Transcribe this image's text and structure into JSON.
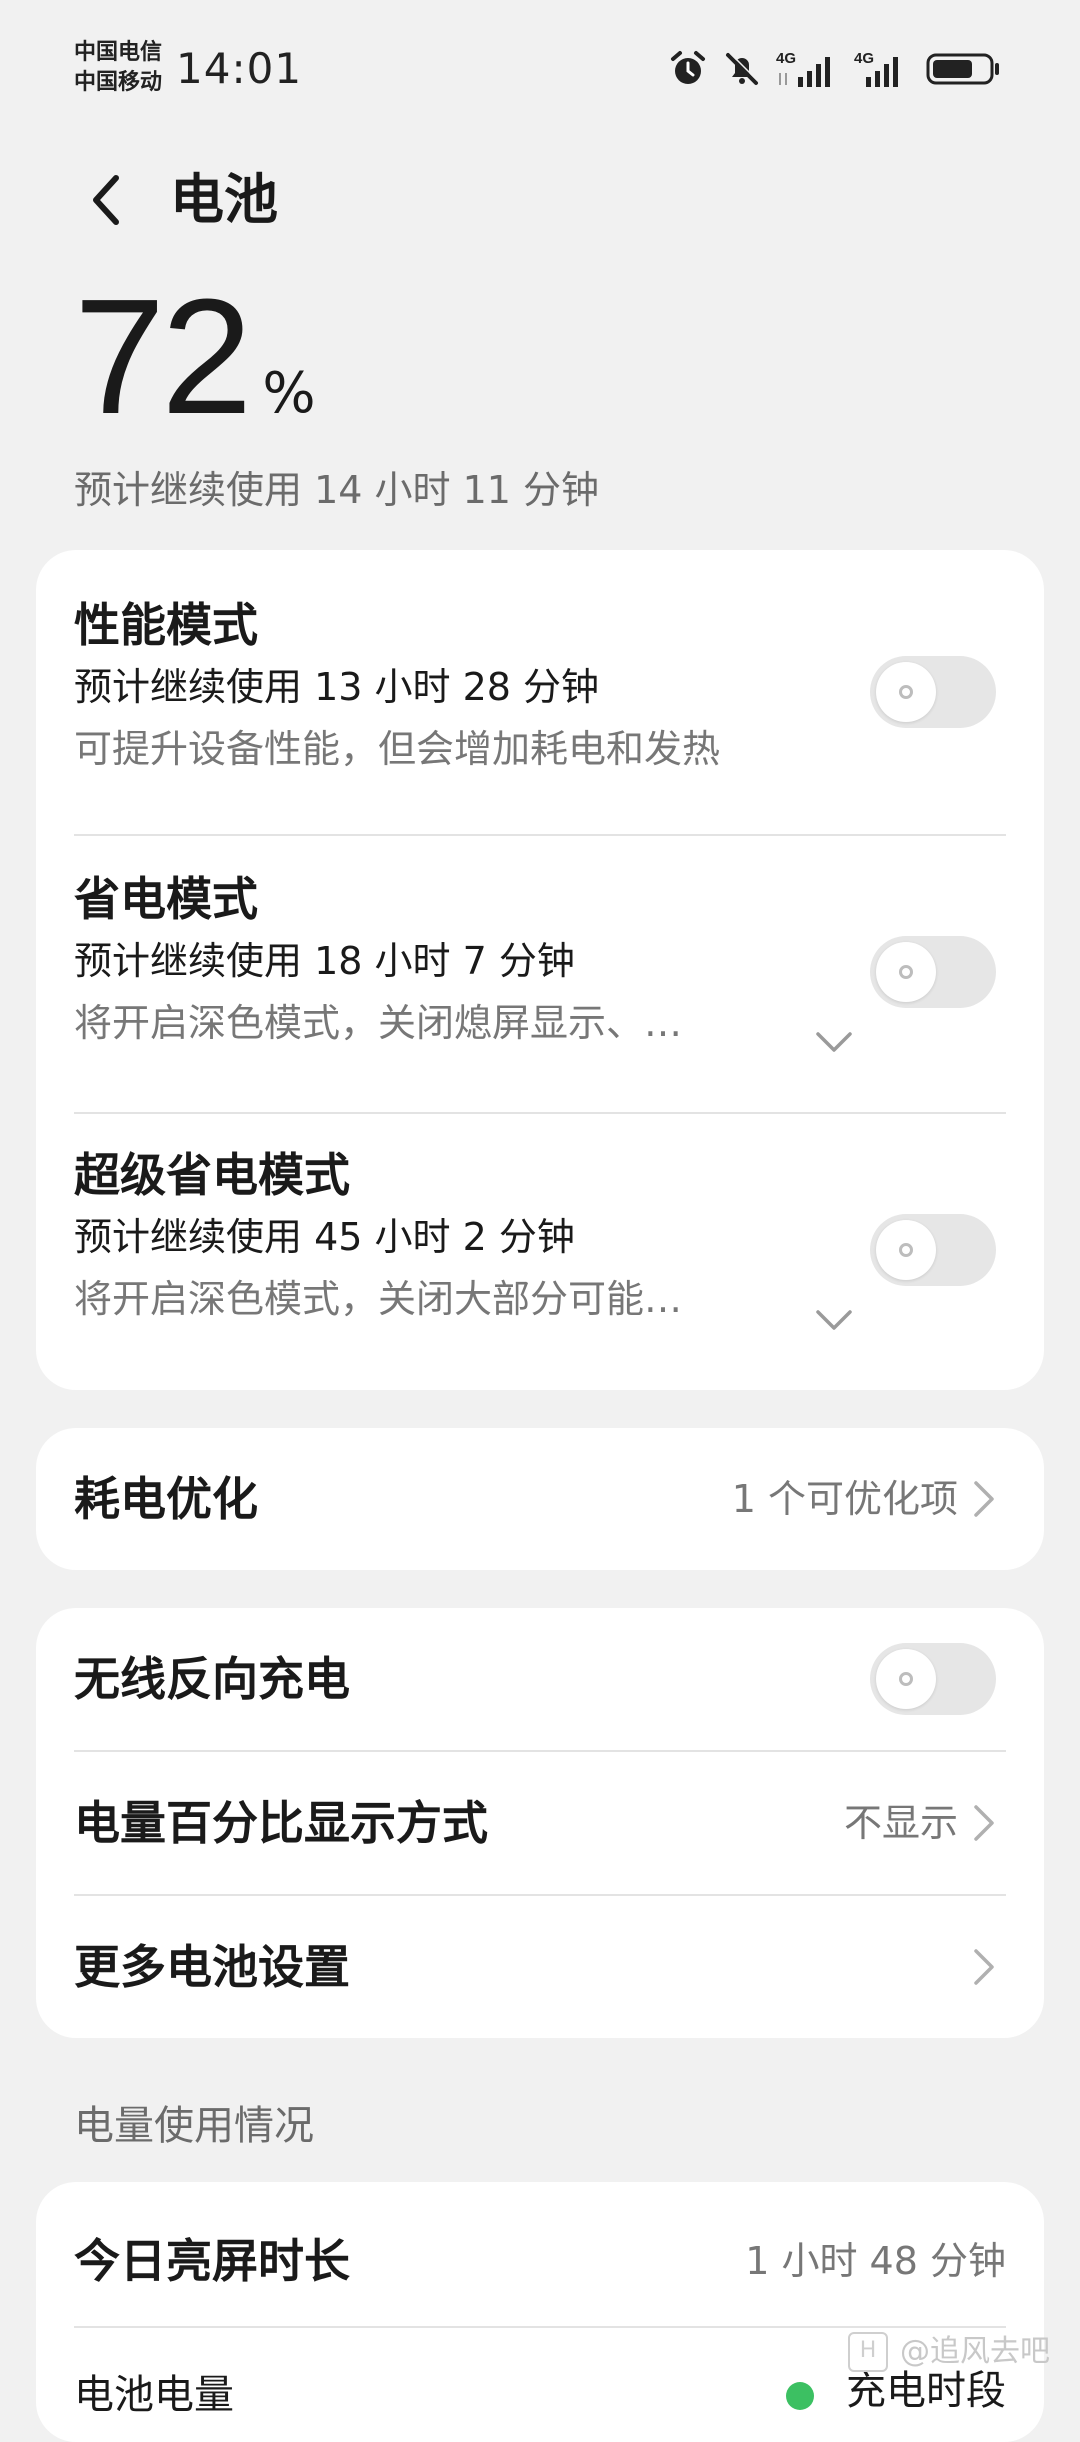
{
  "status_bar": {
    "carrier_1": "中国电信",
    "carrier_2": "中国移动",
    "time": "14:01",
    "icons": [
      "alarm-icon",
      "mute-bell-icon",
      "signal-4g-icon",
      "signal-4g-icon",
      "battery-icon"
    ],
    "network_1": "4G",
    "network_2": "4G",
    "battery_fill": 0.72
  },
  "header": {
    "title": "电池"
  },
  "battery": {
    "level": "72",
    "unit": "%",
    "remaining": "预计继续使用 14 小时 11 分钟"
  },
  "modes": [
    {
      "title": "性能模式",
      "estimate": "预计继续使用 13 小时 28 分钟",
      "description": "可提升设备性能，但会增加耗电和发热",
      "enabled": false,
      "expandable": false
    },
    {
      "title": "省电模式",
      "estimate": "预计继续使用 18 小时 7 分钟",
      "description": "将开启深色模式，关闭熄屏显示、…",
      "enabled": false,
      "expandable": true
    },
    {
      "title": "超级省电模式",
      "estimate": "预计继续使用 45 小时 2 分钟",
      "description": "将开启深色模式，关闭大部分可能…",
      "enabled": false,
      "expandable": true
    }
  ],
  "optimization": {
    "label": "耗电优化",
    "value": "1 个可优化项"
  },
  "settings": {
    "wireless_reverse": {
      "label": "无线反向充电",
      "enabled": false
    },
    "percentage_display": {
      "label": "电量百分比显示方式",
      "value": "不显示"
    },
    "more_settings": {
      "label": "更多电池设置"
    }
  },
  "usage": {
    "section_title": "电量使用情况",
    "screen_time_label": "今日亮屏时长",
    "screen_time_value": "1 小时 48 分钟",
    "battery_level_label": "电池电量",
    "charging_legend": "充电时段",
    "charging_color": "#3cc062"
  },
  "watermark": {
    "logo": "H",
    "text": "@追风去吧"
  }
}
